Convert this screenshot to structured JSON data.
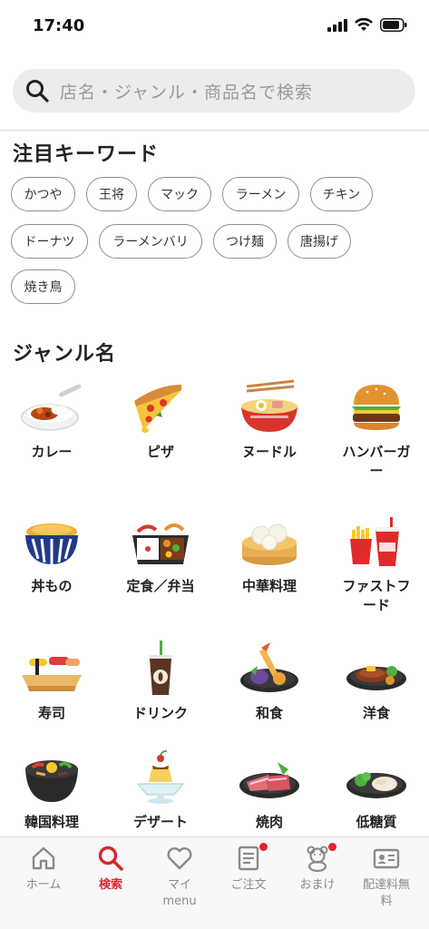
{
  "status_bar": {
    "time": "17:40"
  },
  "search": {
    "placeholder": "店名・ジャンル・商品名で検索"
  },
  "keywords": {
    "title": "注目キーワード",
    "items": [
      "かつや",
      "王将",
      "マック",
      "ラーメン",
      "チキン",
      "ドーナツ",
      "ラーメンバリ",
      "つけ麺",
      "唐揚げ",
      "焼き鳥"
    ]
  },
  "genres": {
    "title": "ジャンル名",
    "items": [
      {
        "label": "カレー",
        "icon": "curry-icon"
      },
      {
        "label": "ピザ",
        "icon": "pizza-icon"
      },
      {
        "label": "ヌードル",
        "icon": "noodle-icon"
      },
      {
        "label": "ハンバーガー",
        "icon": "hamburger-icon"
      },
      {
        "label": "丼もの",
        "icon": "donburi-icon"
      },
      {
        "label": "定食／弁当",
        "icon": "bento-icon"
      },
      {
        "label": "中華料理",
        "icon": "dim-sum-icon"
      },
      {
        "label": "ファストフード",
        "icon": "fast-food-icon"
      },
      {
        "label": "寿司",
        "icon": "sushi-icon"
      },
      {
        "label": "ドリンク",
        "icon": "drink-icon"
      },
      {
        "label": "和食",
        "icon": "tempura-icon"
      },
      {
        "label": "洋食",
        "icon": "steak-icon"
      },
      {
        "label": "韓国料理",
        "icon": "bibimbap-icon"
      },
      {
        "label": "デザート",
        "icon": "pudding-icon"
      },
      {
        "label": "焼肉",
        "icon": "yakiniku-icon"
      },
      {
        "label": "低糖質",
        "icon": "low-carb-icon"
      }
    ]
  },
  "tab_bar": {
    "items": [
      {
        "label": "ホーム",
        "icon": "home-icon",
        "active": false,
        "badge": false
      },
      {
        "label": "検索",
        "icon": "search-icon",
        "active": true,
        "badge": false
      },
      {
        "label": "マイmenu",
        "icon": "heart-icon",
        "active": false,
        "badge": false
      },
      {
        "label": "ご注文",
        "icon": "order-icon",
        "active": false,
        "badge": true
      },
      {
        "label": "おまけ",
        "icon": "bear-icon",
        "active": false,
        "badge": true
      },
      {
        "label": "配達料無料",
        "icon": "card-icon",
        "active": false,
        "badge": false
      }
    ]
  },
  "colors": {
    "accent": "#d8272f",
    "badge": "#e4232a",
    "chip_border": "#8f8f8f",
    "search_bg": "#ececec"
  }
}
